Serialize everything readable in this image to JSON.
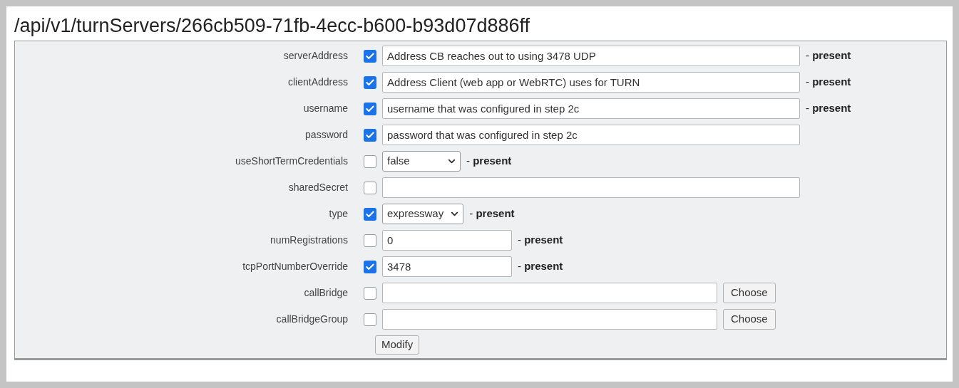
{
  "title": "/api/v1/turnServers/266cb509-71fb-4ecc-b600-b93d07d886ff",
  "rows": [
    {
      "label": "serverAddress",
      "checked": true,
      "kind": "text",
      "value": "Address CB reaches out to using 3478 UDP",
      "note": "- **present**"
    },
    {
      "label": "clientAddress",
      "checked": true,
      "kind": "text",
      "value": "Address Client (web app or WebRTC) uses for TURN",
      "note": "- **present**"
    },
    {
      "label": "username",
      "checked": true,
      "kind": "text",
      "value": "username that was configured in step 2c",
      "note": "- **present**"
    },
    {
      "label": "password",
      "checked": true,
      "kind": "text",
      "value": "password that was configured in step 2c"
    },
    {
      "label": "useShortTermCredentials",
      "checked": false,
      "kind": "select",
      "value": "false",
      "note": "- **present**"
    },
    {
      "label": "sharedSecret",
      "checked": false,
      "kind": "text"
    },
    {
      "label": "type",
      "checked": true,
      "kind": "select",
      "value": "expressway",
      "note": "- **present**"
    },
    {
      "label": "numRegistrations",
      "checked": false,
      "kind": "short",
      "value": "0",
      "note": "- **present**"
    },
    {
      "label": "tcpPortNumberOverride",
      "checked": true,
      "kind": "short",
      "value": "3478",
      "note": "- **present**"
    },
    {
      "label": "callBridge",
      "checked": false,
      "kind": "chooser",
      "button": "Choose"
    },
    {
      "label": "callBridgeGroup",
      "checked": false,
      "kind": "chooser",
      "button": "Choose"
    }
  ],
  "submit": "Modify"
}
